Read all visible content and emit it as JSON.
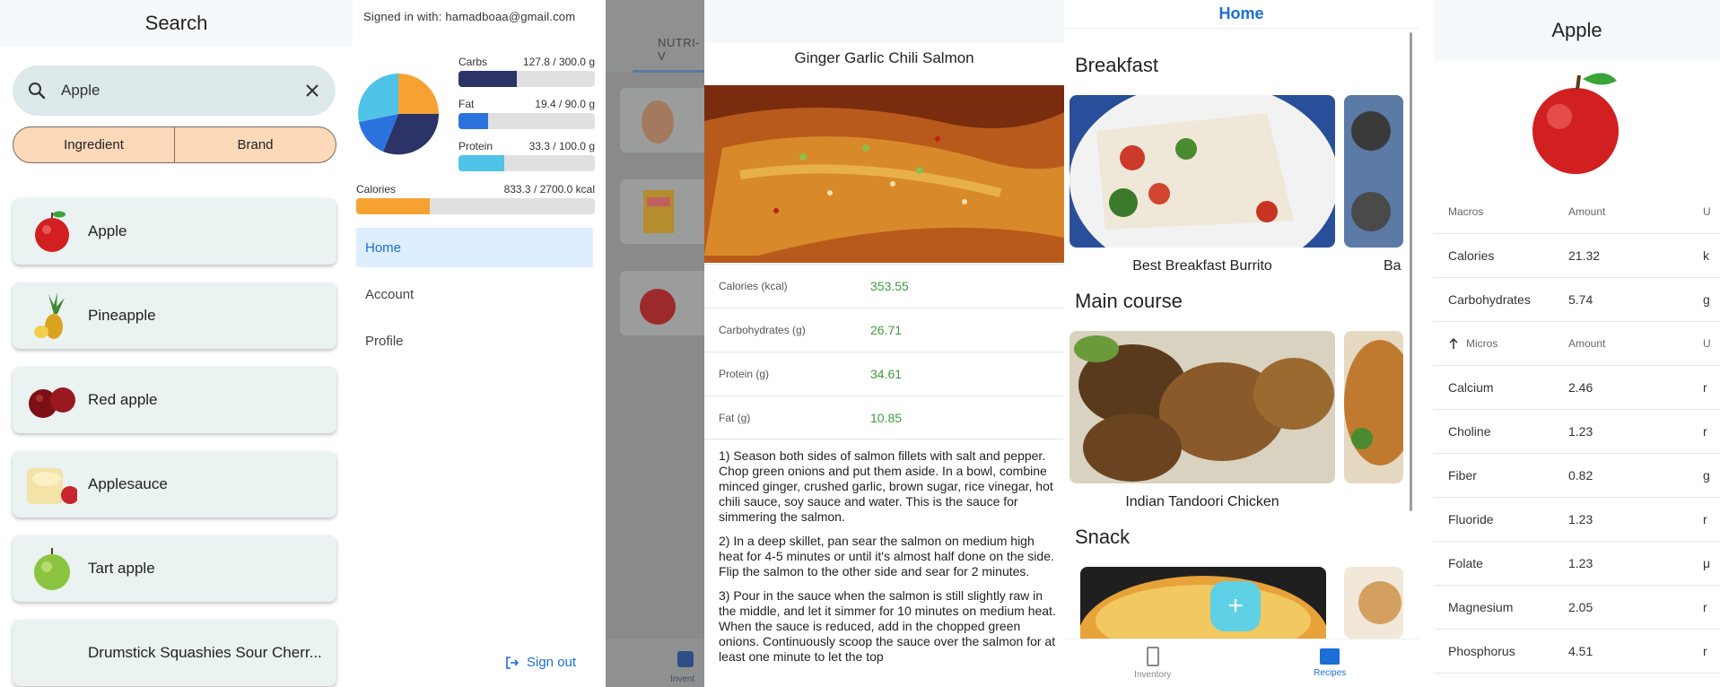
{
  "search_screen": {
    "title": "Search",
    "query": "Apple",
    "segments": [
      "Ingredient",
      "Brand"
    ],
    "results": [
      "Apple",
      "Pineapple",
      "Red apple",
      "Applesauce",
      "Tart apple",
      "Drumstick Squashies Sour Cherr..."
    ]
  },
  "drawer": {
    "signed_in": "Signed in with: hamadboaa@gmail.com",
    "macros": [
      {
        "label": "Carbs",
        "value_text": "127.8 / 300.0 g",
        "fraction": 0.426,
        "color": "#2c3367"
      },
      {
        "label": "Fat",
        "value_text": "19.4 / 90.0 g",
        "fraction": 0.216,
        "color": "#2b72de"
      },
      {
        "label": "Protein",
        "value_text": "33.3 / 100.0 g",
        "fraction": 0.333,
        "color": "#4fc3e8"
      }
    ],
    "calories": {
      "label": "Calories",
      "value_text": "833.3 / 2700.0 kcal",
      "fraction": 0.309,
      "color": "#f6a233"
    },
    "pie_colors": [
      "#f6a233",
      "#2c3367",
      "#2b72de",
      "#4fc3e8"
    ],
    "nav": [
      "Home",
      "Account",
      "Profile"
    ],
    "sign_out": "Sign out"
  },
  "background_screen": {
    "tab": "NUTRI-V",
    "bottom_label": "Invent"
  },
  "recipe": {
    "title": "Ginger Garlic Chili Salmon",
    "nutrition": [
      {
        "label": "Calories (kcal)",
        "value": "353.55"
      },
      {
        "label": "Carbohydrates (g)",
        "value": "26.71"
      },
      {
        "label": "Protein (g)",
        "value": "34.61"
      },
      {
        "label": "Fat (g)",
        "value": "10.85"
      }
    ],
    "steps": [
      "1) Season both sides of salmon fillets with salt and pepper. Chop green onions and put them aside. In a bowl, combine minced ginger, crushed garlic, brown sugar, rice vinegar, hot chili sauce, soy sauce and water. This is the sauce for simmering the salmon.",
      "2) In a deep skillet, pan sear the salmon on medium high heat for 4-5 minutes or until it's almost half done on the side. Flip the salmon to the other side and sear for 2 minutes.",
      "3) Pour in the sauce when the salmon is still slightly raw in the middle, and let it simmer for 10 minutes on medium heat. When the sauce is reduced, add in the chopped green onions. Continuously scoop the sauce over the salmon for at least one minute to let the top"
    ]
  },
  "recipes_home": {
    "title": "Home",
    "sections": [
      {
        "name": "Breakfast",
        "card": "Best Breakfast Burrito",
        "next_card": "Ba"
      },
      {
        "name": "Main course",
        "card": "Indian Tandoori Chicken",
        "next_card": ""
      },
      {
        "name": "Snack",
        "card": "",
        "next_card": ""
      }
    ],
    "fab": "+",
    "bottom_nav": [
      "Inventory",
      "Recipes"
    ]
  },
  "food_detail": {
    "title": "Apple",
    "macros_header": [
      "Macros",
      "Amount",
      "U"
    ],
    "macros": [
      {
        "name": "Calories",
        "amount": "21.32",
        "unit": "k"
      },
      {
        "name": "Carbohydrates",
        "amount": "5.74",
        "unit": "g"
      }
    ],
    "micros_header": [
      "Micros",
      "Amount",
      "U"
    ],
    "micros": [
      {
        "name": "Calcium",
        "amount": "2.46",
        "unit": "r"
      },
      {
        "name": "Choline",
        "amount": "1.23",
        "unit": "r"
      },
      {
        "name": "Fiber",
        "amount": "0.82",
        "unit": "g"
      },
      {
        "name": "Fluoride",
        "amount": "1.23",
        "unit": "r"
      },
      {
        "name": "Folate",
        "amount": "1.23",
        "unit": "μ"
      },
      {
        "name": "Magnesium",
        "amount": "2.05",
        "unit": "r"
      },
      {
        "name": "Phosphorus",
        "amount": "4.51",
        "unit": "r"
      }
    ]
  }
}
